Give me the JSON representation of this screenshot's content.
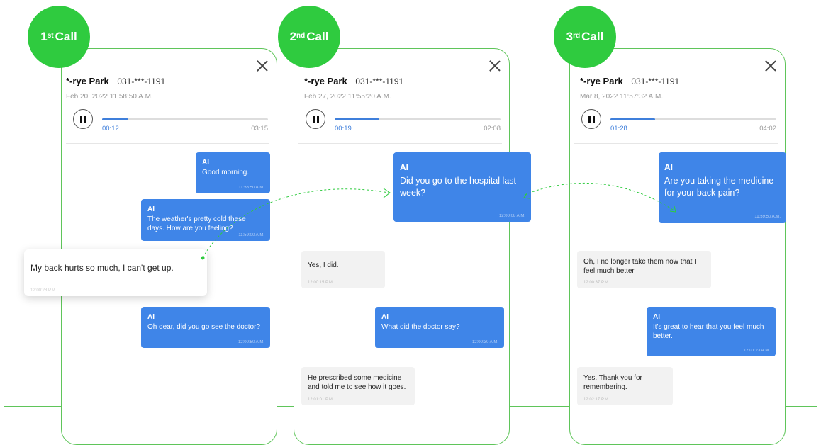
{
  "calls": [
    {
      "badge_num": "1",
      "badge_sup": "st",
      "badge_word": "Call",
      "name": "*-rye Park",
      "number": "031-***-1191",
      "date": "Feb 20, 2022 11:58:50 A.M.",
      "current_time": "00:12",
      "total_time": "03:15",
      "progress": 0.16,
      "messages": [
        {
          "sender": "AI",
          "text": "Good morning.",
          "time": "11:58:50 A.M."
        },
        {
          "sender": "AI",
          "text": "The weather's pretty cold these days. How are you feeling?",
          "time": "11:59:00 A.M."
        },
        {
          "sender": "AI",
          "text": "Oh dear, did you go see the doctor?",
          "time": "12:00:50 A.M."
        }
      ],
      "highlight": {
        "text": "My back hurts so much, I can't get up.",
        "time": "12:00:28 P.M."
      }
    },
    {
      "badge_num": "2",
      "badge_sup": "nd",
      "badge_word": "Call",
      "name": "*-rye Park",
      "number": "031-***-1191",
      "date": "Feb 27, 2022 11:55:20 A.M.",
      "current_time": "00:19",
      "total_time": "02:08",
      "progress": 0.27,
      "messages": [
        {
          "sender": "AI",
          "text": "Did you go to the hospital last week?",
          "time": "12:00:08 A.M."
        },
        {
          "sender": "",
          "text": "Yes, I did.",
          "time": "12:00:15 P.M."
        },
        {
          "sender": "AI",
          "text": "What did the doctor say?",
          "time": "12:00:30 A.M."
        },
        {
          "sender": "",
          "text": "He prescribed some medicine and told me to see how it goes.",
          "time": "12:01:01 P.M."
        }
      ]
    },
    {
      "badge_num": "3",
      "badge_sup": "rd",
      "badge_word": "Call",
      "name": "*-rye Park",
      "number": "031-***-1191",
      "date": "Mar 8, 2022 11:57:32 A.M.",
      "current_time": "01:28",
      "total_time": "04:02",
      "progress": 0.27,
      "messages": [
        {
          "sender": "AI",
          "text": "Are you taking the medicine for your back pain?",
          "time": "11:59:50 A.M."
        },
        {
          "sender": "",
          "text": "Oh, I no longer take them now that I feel much better.",
          "time": "12:00:37 P.M."
        },
        {
          "sender": "AI",
          "text": "It's great to hear that you feel much better.",
          "time": "12:01:23 A.M."
        },
        {
          "sender": "",
          "text": "Yes. Thank you for remembering.",
          "time": "12:02:17 P.M."
        }
      ]
    }
  ],
  "colors": {
    "accent_green": "#2fcb3f",
    "ai_bubble": "#3f85e8",
    "outline": "#5fc55a"
  }
}
